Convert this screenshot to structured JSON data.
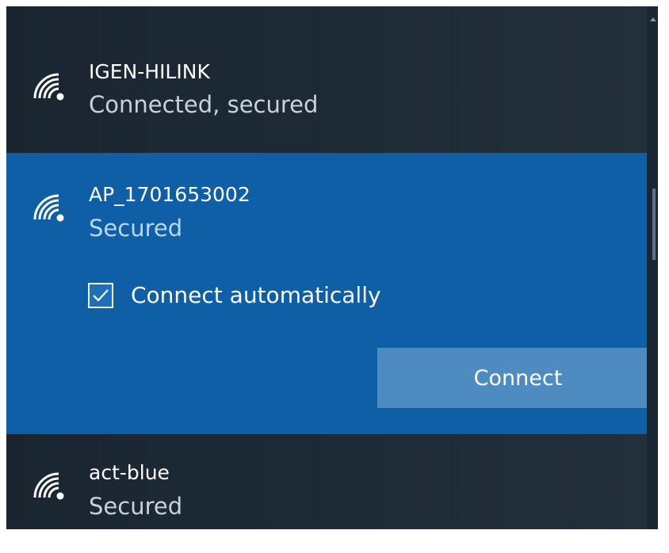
{
  "networks": [
    {
      "ssid": "IGEN-HILINK",
      "status": "Connected, secured"
    },
    {
      "ssid": "AP_1701653002",
      "status": "Secured"
    },
    {
      "ssid": "act-blue",
      "status": "Secured"
    }
  ],
  "selected_network": {
    "connect_automatically_label": "Connect automatically",
    "connect_automatically_checked": true,
    "connect_button_label": "Connect"
  },
  "icons": {
    "network_icon": "wifi-secured-icon",
    "checkbox_icon": "checkmark-icon"
  },
  "colors": {
    "panel_background": "#1d2a36",
    "selected_background": "#0f5fa6",
    "button_background": "#4d8bc1"
  }
}
